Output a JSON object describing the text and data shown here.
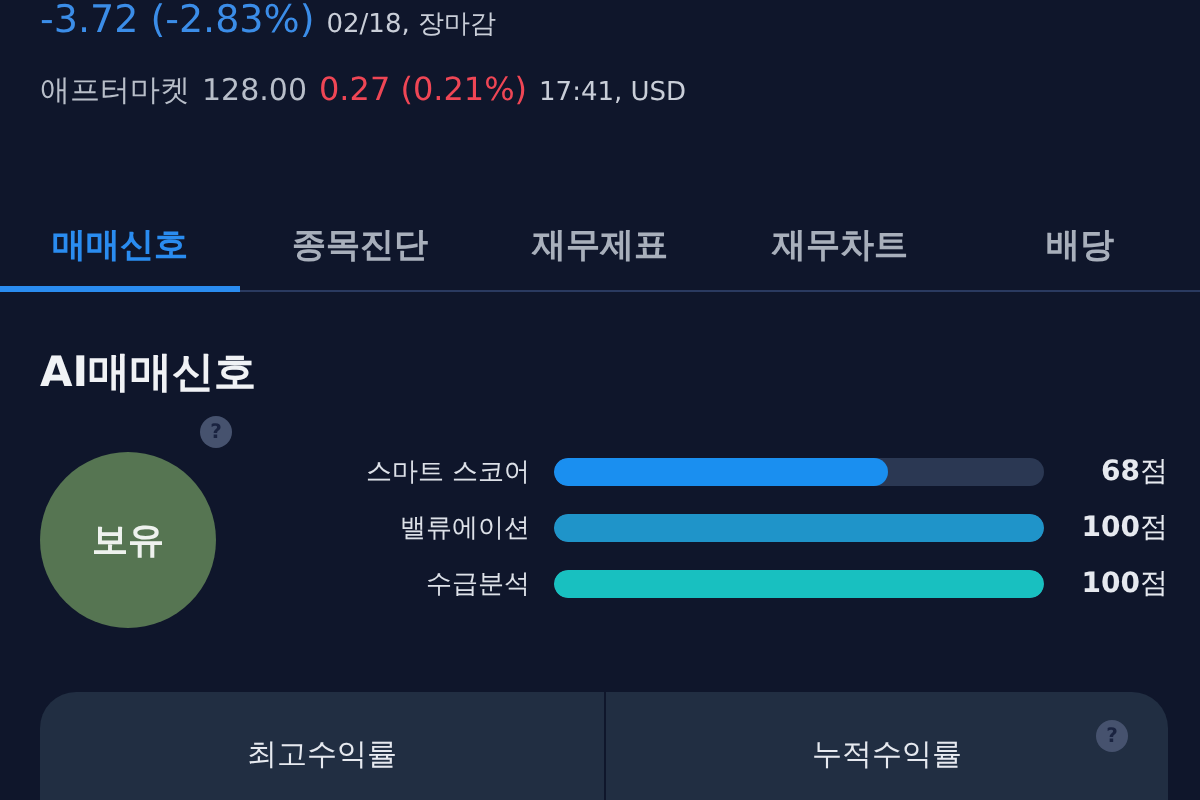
{
  "quote": {
    "change": "-3.72 (-2.83%)",
    "date": "02/18, 장마감"
  },
  "after_market": {
    "label": "애프터마켓",
    "price": "128.00",
    "change": "0.27 (0.21%)",
    "time": "17:41, USD"
  },
  "tabs": [
    {
      "label": "매매신호",
      "selected": true
    },
    {
      "label": "종목진단",
      "selected": false
    },
    {
      "label": "재무제표",
      "selected": false
    },
    {
      "label": "재무차트",
      "selected": false
    },
    {
      "label": "배당",
      "selected": false
    }
  ],
  "signal": {
    "title": "AI매매신호",
    "badge": "보유",
    "help": "?",
    "scores": [
      {
        "label": "스마트 스코어",
        "level": 0.68,
        "color": "#1a8ff0",
        "value": "68",
        "unit": "점"
      },
      {
        "label": "밸류에이션",
        "level": 1.0,
        "color": "#1f94c9",
        "value": "100",
        "unit": "점"
      },
      {
        "label": "수급분석",
        "level": 1.0,
        "color": "#18c0c0",
        "value": "100",
        "unit": "점"
      }
    ]
  },
  "returns": {
    "columns": [
      "최고수익률",
      "누적수익률"
    ],
    "help": "?"
  }
}
